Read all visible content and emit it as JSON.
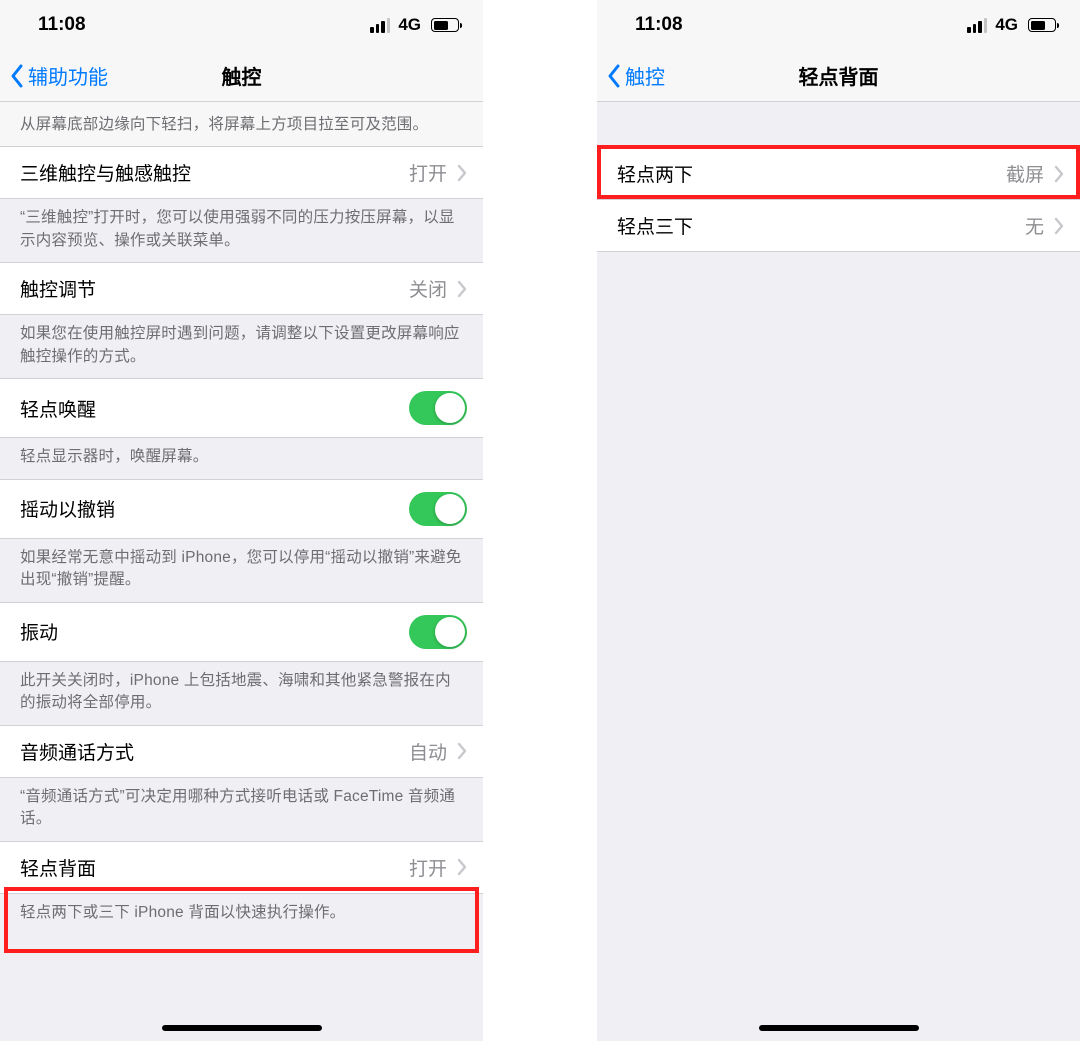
{
  "status": {
    "time": "11:08",
    "network": "4G"
  },
  "left": {
    "back": "辅助功能",
    "title": "触控",
    "header_note": "从屏幕底部边缘向下轻扫，将屏幕上方项目拉至可及范围。",
    "row_3d_touch": {
      "label": "三维触控与触感触控",
      "value": "打开"
    },
    "note_3d_touch": "“三维触控”打开时，您可以使用强弱不同的压力按压屏幕，以显示内容预览、操作或关联菜单。",
    "row_touch_accom": {
      "label": "触控调节",
      "value": "关闭"
    },
    "note_touch_accom": "如果您在使用触控屏时遇到问题，请调整以下设置更改屏幕响应触控操作的方式。",
    "row_tap_wake": {
      "label": "轻点唤醒"
    },
    "note_tap_wake": "轻点显示器时，唤醒屏幕。",
    "row_shake_undo": {
      "label": "摇动以撤销"
    },
    "note_shake_undo": "如果经常无意中摇动到 iPhone，您可以停用“摇动以撤销”来避免出现“撤销”提醒。",
    "row_vibration": {
      "label": "振动"
    },
    "note_vibration": "此开关关闭时，iPhone 上包括地震、海啸和其他紧急警报在内的振动将全部停用。",
    "row_audio_call": {
      "label": "音频通话方式",
      "value": "自动"
    },
    "note_audio_call": "“音频通话方式”可决定用哪种方式接听电话或 FaceTime 音频通话。",
    "row_back_tap": {
      "label": "轻点背面",
      "value": "打开"
    },
    "note_back_tap": "轻点两下或三下 iPhone 背面以快速执行操作。"
  },
  "right": {
    "back": "触控",
    "title": "轻点背面",
    "row_double": {
      "label": "轻点两下",
      "value": "截屏"
    },
    "row_triple": {
      "label": "轻点三下",
      "value": "无"
    }
  }
}
